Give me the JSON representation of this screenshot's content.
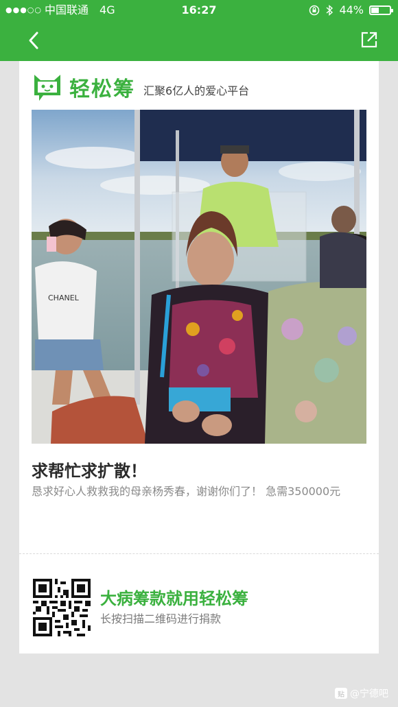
{
  "status_bar": {
    "signal_dots": "●●●○○",
    "carrier": "中国联通",
    "network": "4G",
    "time": "16:27",
    "battery_text": "44%",
    "battery_level": 0.44
  },
  "brand": {
    "name": "轻松筹",
    "slogan": "汇聚6亿人的爱心平台",
    "color": "#3bb13f"
  },
  "post": {
    "title": "求帮忙求扩散！",
    "description": "恳求好心人救救我的母亲杨秀春，谢谢你们了！ 急需350000元"
  },
  "footer": {
    "cta": "大病筹款就用轻松筹",
    "sub": "长按扫描二维码进行捐款"
  },
  "watermark": {
    "icon_text": "贴",
    "text": "@宁德吧"
  },
  "photo_text": {
    "shirt": "CHANEL"
  },
  "icons": {
    "back": "chevron-left-icon",
    "share": "share-external-icon",
    "bluetooth": "bluetooth-icon",
    "lock": "rotation-lock-icon"
  }
}
